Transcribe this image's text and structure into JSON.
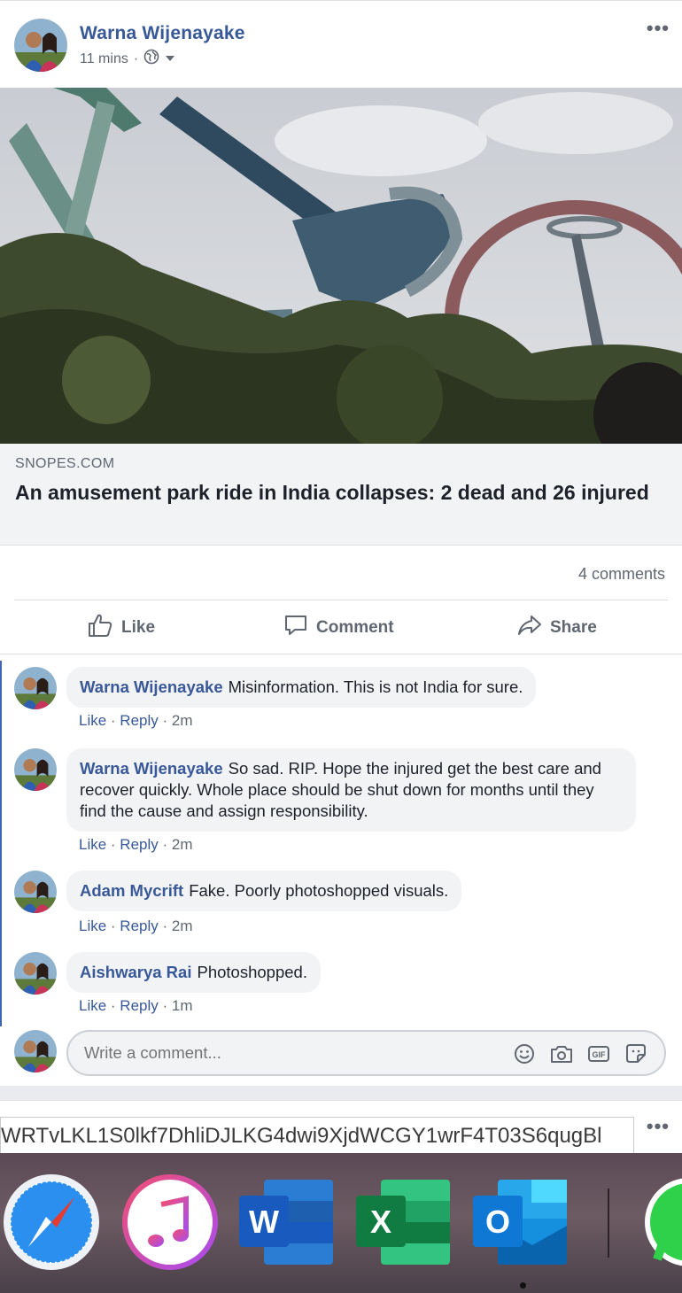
{
  "post": {
    "author": "Warna Wijenayake",
    "time": "11 mins",
    "privacy_icon": "globe-icon",
    "link": {
      "domain": "SNOPES.COM",
      "headline": "An amusement park ride in India collapses: 2 dead and 26 injured"
    },
    "comment_count": "4 comments",
    "actions": {
      "like": "Like",
      "comment": "Comment",
      "share": "Share"
    }
  },
  "comments": [
    {
      "name": "Warna Wijenayake",
      "text": "Misinformation. This is not India for sure.",
      "like": "Like",
      "reply": "Reply",
      "time": "2m"
    },
    {
      "name": "Warna Wijenayake",
      "text": "So sad. RIP. Hope the injured get the best care and recover quickly. Whole place should be shut down for months until they find the cause and assign responsibility.",
      "like": "Like",
      "reply": "Reply",
      "time": "2m"
    },
    {
      "name": "Adam Mycrift",
      "text": "Fake. Poorly photoshopped visuals.",
      "like": "Like",
      "reply": "Reply",
      "time": "2m"
    },
    {
      "name": "Aishwarya Rai",
      "text": "Photoshopped.",
      "like": "Like",
      "reply": "Reply",
      "time": "1m"
    }
  ],
  "composer": {
    "placeholder": "Write a comment..."
  },
  "next_post": {
    "url_text": "WRTvLKL1S0lkf7DhliDJLKG4dwi9XjdWCGY1wrF4T03S6qugBl"
  },
  "dock": {
    "apps": [
      "Safari",
      "iTunes",
      "Word",
      "Excel",
      "Outlook",
      "WhatsApp"
    ],
    "word_letter": "W",
    "excel_letter": "X",
    "outlook_letter": "O"
  }
}
